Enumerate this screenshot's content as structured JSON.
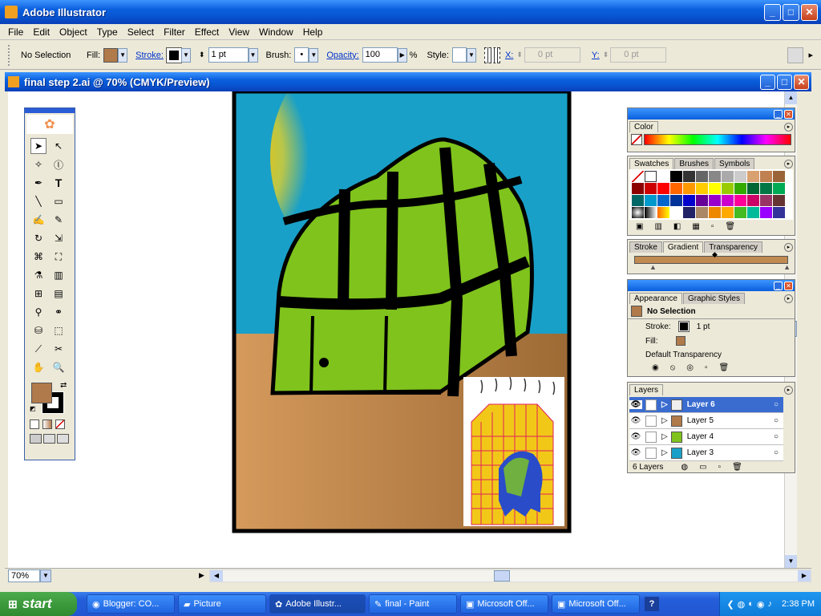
{
  "app": {
    "title": "Adobe Illustrator"
  },
  "menu": [
    "File",
    "Edit",
    "Object",
    "Type",
    "Select",
    "Filter",
    "Effect",
    "View",
    "Window",
    "Help"
  ],
  "control": {
    "selection": "No Selection",
    "fill_label": "Fill:",
    "stroke_label": "Stroke:",
    "stroke_weight": "1 pt",
    "brush_label": "Brush:",
    "opacity_label": "Opacity:",
    "opacity_value": "100",
    "percent": "%",
    "style_label": "Style:",
    "x_label": "X:",
    "x_value": "0 pt",
    "y_label": "Y:",
    "y_value": "0 pt",
    "fill_color": "#b07a4a"
  },
  "document": {
    "title": "final step 2.ai @ 70% (CMYK/Preview)",
    "zoom": "70%"
  },
  "color_panel": {
    "tab": "Color"
  },
  "swatch_panel": {
    "tabs": [
      "Swatches",
      "Brushes",
      "Symbols"
    ]
  },
  "gradient_panel": {
    "tabs": [
      "Stroke",
      "Gradient",
      "Transparency"
    ]
  },
  "appearance_panel": {
    "tabs": [
      "Appearance",
      "Graphic Styles"
    ],
    "header": "No Selection",
    "stroke_label": "Stroke:",
    "stroke_value": "1 pt",
    "fill_label": "Fill:",
    "transparency": "Default Transparency"
  },
  "layers_panel": {
    "tab": "Layers",
    "layers": [
      "Layer 6",
      "Layer 5",
      "Layer 4",
      "Layer 3"
    ],
    "count": "6 Layers"
  },
  "taskbar": {
    "start": "start",
    "items": [
      "Blogger: CO...",
      "Picture",
      "Adobe Illustr...",
      "final - Paint",
      "Microsoft Off...",
      "Microsoft Off..."
    ],
    "clock": "2:38 PM"
  },
  "colors": {
    "titlebar": "#0a5fdd",
    "sky": "#1aa0c8",
    "sun": "#f5c000",
    "greenhouse": "#7fc31c",
    "ground": "#c08a50",
    "taskbar": "#245edb",
    "start": "#3c9a3c"
  }
}
